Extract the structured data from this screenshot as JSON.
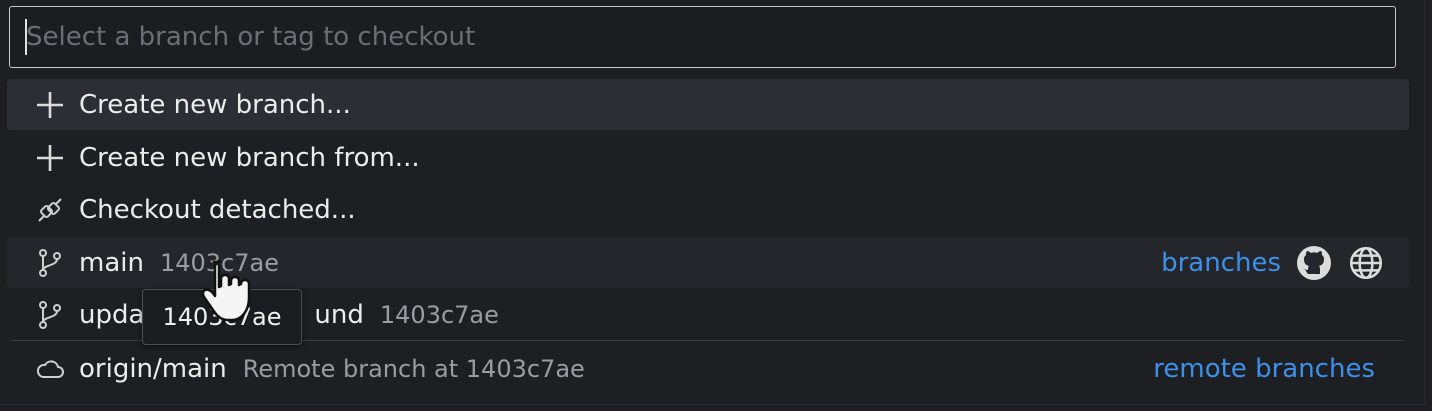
{
  "search": {
    "placeholder": "Select a branch or tag to checkout"
  },
  "actions": [
    {
      "label": "Create new branch...",
      "icon": "plus-icon"
    },
    {
      "label": "Create new branch from...",
      "icon": "plus-icon"
    },
    {
      "label": "Checkout detached...",
      "icon": "detached-icon"
    }
  ],
  "branches": {
    "link": "branches",
    "items": [
      {
        "name": "main",
        "commit": "1403c7ae",
        "icon": "git-branch-icon"
      },
      {
        "name": "upda",
        "name_tail": "und",
        "commit": "1403c7ae",
        "icon": "git-branch-icon"
      }
    ]
  },
  "remotes": {
    "link": "remote branches",
    "items": [
      {
        "name": "origin/main",
        "desc": "Remote branch at 1403c7ae",
        "icon": "cloud-icon"
      }
    ]
  },
  "tooltip": {
    "text": "1403c7ae"
  },
  "colors": {
    "accent": "#3d8fe8",
    "highlight": "#2c2e35",
    "background": "#1e1f23"
  }
}
